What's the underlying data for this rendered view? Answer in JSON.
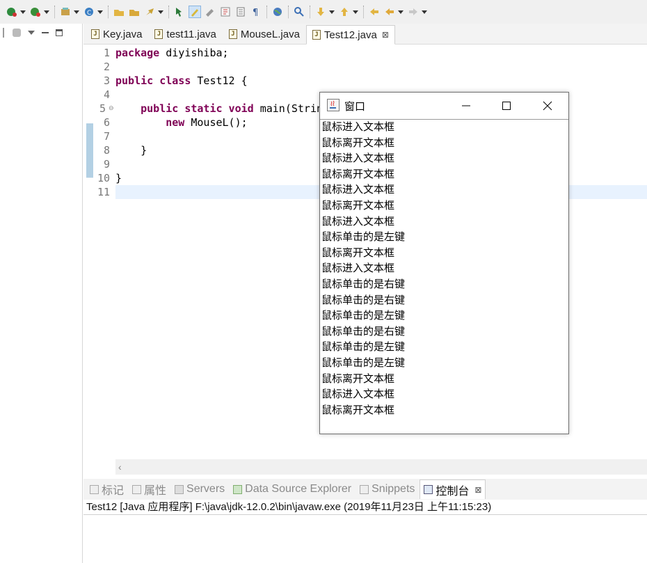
{
  "toolbar": {
    "icons": [
      "debug-icon",
      "run-icon",
      "new-package-icon",
      "new-class-icon",
      "open-type-icon",
      "open-folder-icon",
      "pin-icon",
      "toggle-mark-icon",
      "highlight-icon",
      "block-select-icon",
      "show-whitespace-icon",
      "pilcrow-icon",
      "globe-icon",
      "search-refs-icon",
      "next-annotation-icon",
      "prev-annotation-icon",
      "last-edit-icon",
      "back-icon",
      "forward-icon"
    ]
  },
  "editor": {
    "tabs": [
      {
        "label": "Key.java",
        "active": false
      },
      {
        "label": "test11.java",
        "active": false
      },
      {
        "label": "MouseL.java",
        "active": false
      },
      {
        "label": "Test12.java",
        "active": true
      }
    ],
    "tab_close_glyph": "⊠",
    "line_numbers": [
      "1",
      "2",
      "3",
      "4",
      "5",
      "6",
      "7",
      "8",
      "9",
      "10",
      "11"
    ],
    "code_lines": [
      {
        "kw": "package",
        "rest": " diyishiba;",
        "indent": ""
      },
      {
        "kw": "",
        "rest": "",
        "indent": ""
      },
      {
        "kw": "public class",
        "rest": " Test12 {",
        "indent": ""
      },
      {
        "kw": "",
        "rest": "",
        "indent": ""
      },
      {
        "kw": "public static void",
        "rest": " main(Strin",
        "indent": "    "
      },
      {
        "kw": "new",
        "rest": " MouseL();",
        "indent": "        "
      },
      {
        "kw": "",
        "rest": "",
        "indent": ""
      },
      {
        "kw": "",
        "rest": "}",
        "indent": "    "
      },
      {
        "kw": "",
        "rest": "",
        "indent": ""
      },
      {
        "kw": "",
        "rest": "}",
        "indent": ""
      },
      {
        "kw": "",
        "rest": "",
        "indent": ""
      }
    ]
  },
  "bottom": {
    "view_tabs": [
      {
        "label": "标记",
        "active": false
      },
      {
        "label": "属性",
        "active": false
      },
      {
        "label": "Servers",
        "active": false
      },
      {
        "label": "Data Source Explorer",
        "active": false
      },
      {
        "label": "Snippets",
        "active": false
      },
      {
        "label": "控制台",
        "active": true
      }
    ],
    "console_text": "Test12 [Java 应用程序] F:\\java\\jdk-12.0.2\\bin\\javaw.exe  (2019年11月23日 上午11:15:23)"
  },
  "swing_window": {
    "title": "窗口",
    "items": [
      "鼠标进入文本框",
      "鼠标离开文本框",
      "鼠标进入文本框",
      "鼠标离开文本框",
      "鼠标进入文本框",
      "鼠标离开文本框",
      "鼠标进入文本框",
      "鼠标单击的是左键",
      "鼠标离开文本框",
      "鼠标进入文本框",
      "鼠标单击的是右键",
      "鼠标单击的是右键",
      "鼠标单击的是左键",
      "鼠标单击的是右键",
      "鼠标单击的是左键",
      "鼠标单击的是左键",
      "鼠标离开文本框",
      "鼠标进入文本框",
      "鼠标离开文本框"
    ]
  },
  "colors": {
    "keyword": "#7f0055",
    "current_line": "#e8f2fe",
    "change_marker": "#8fb9d6"
  }
}
